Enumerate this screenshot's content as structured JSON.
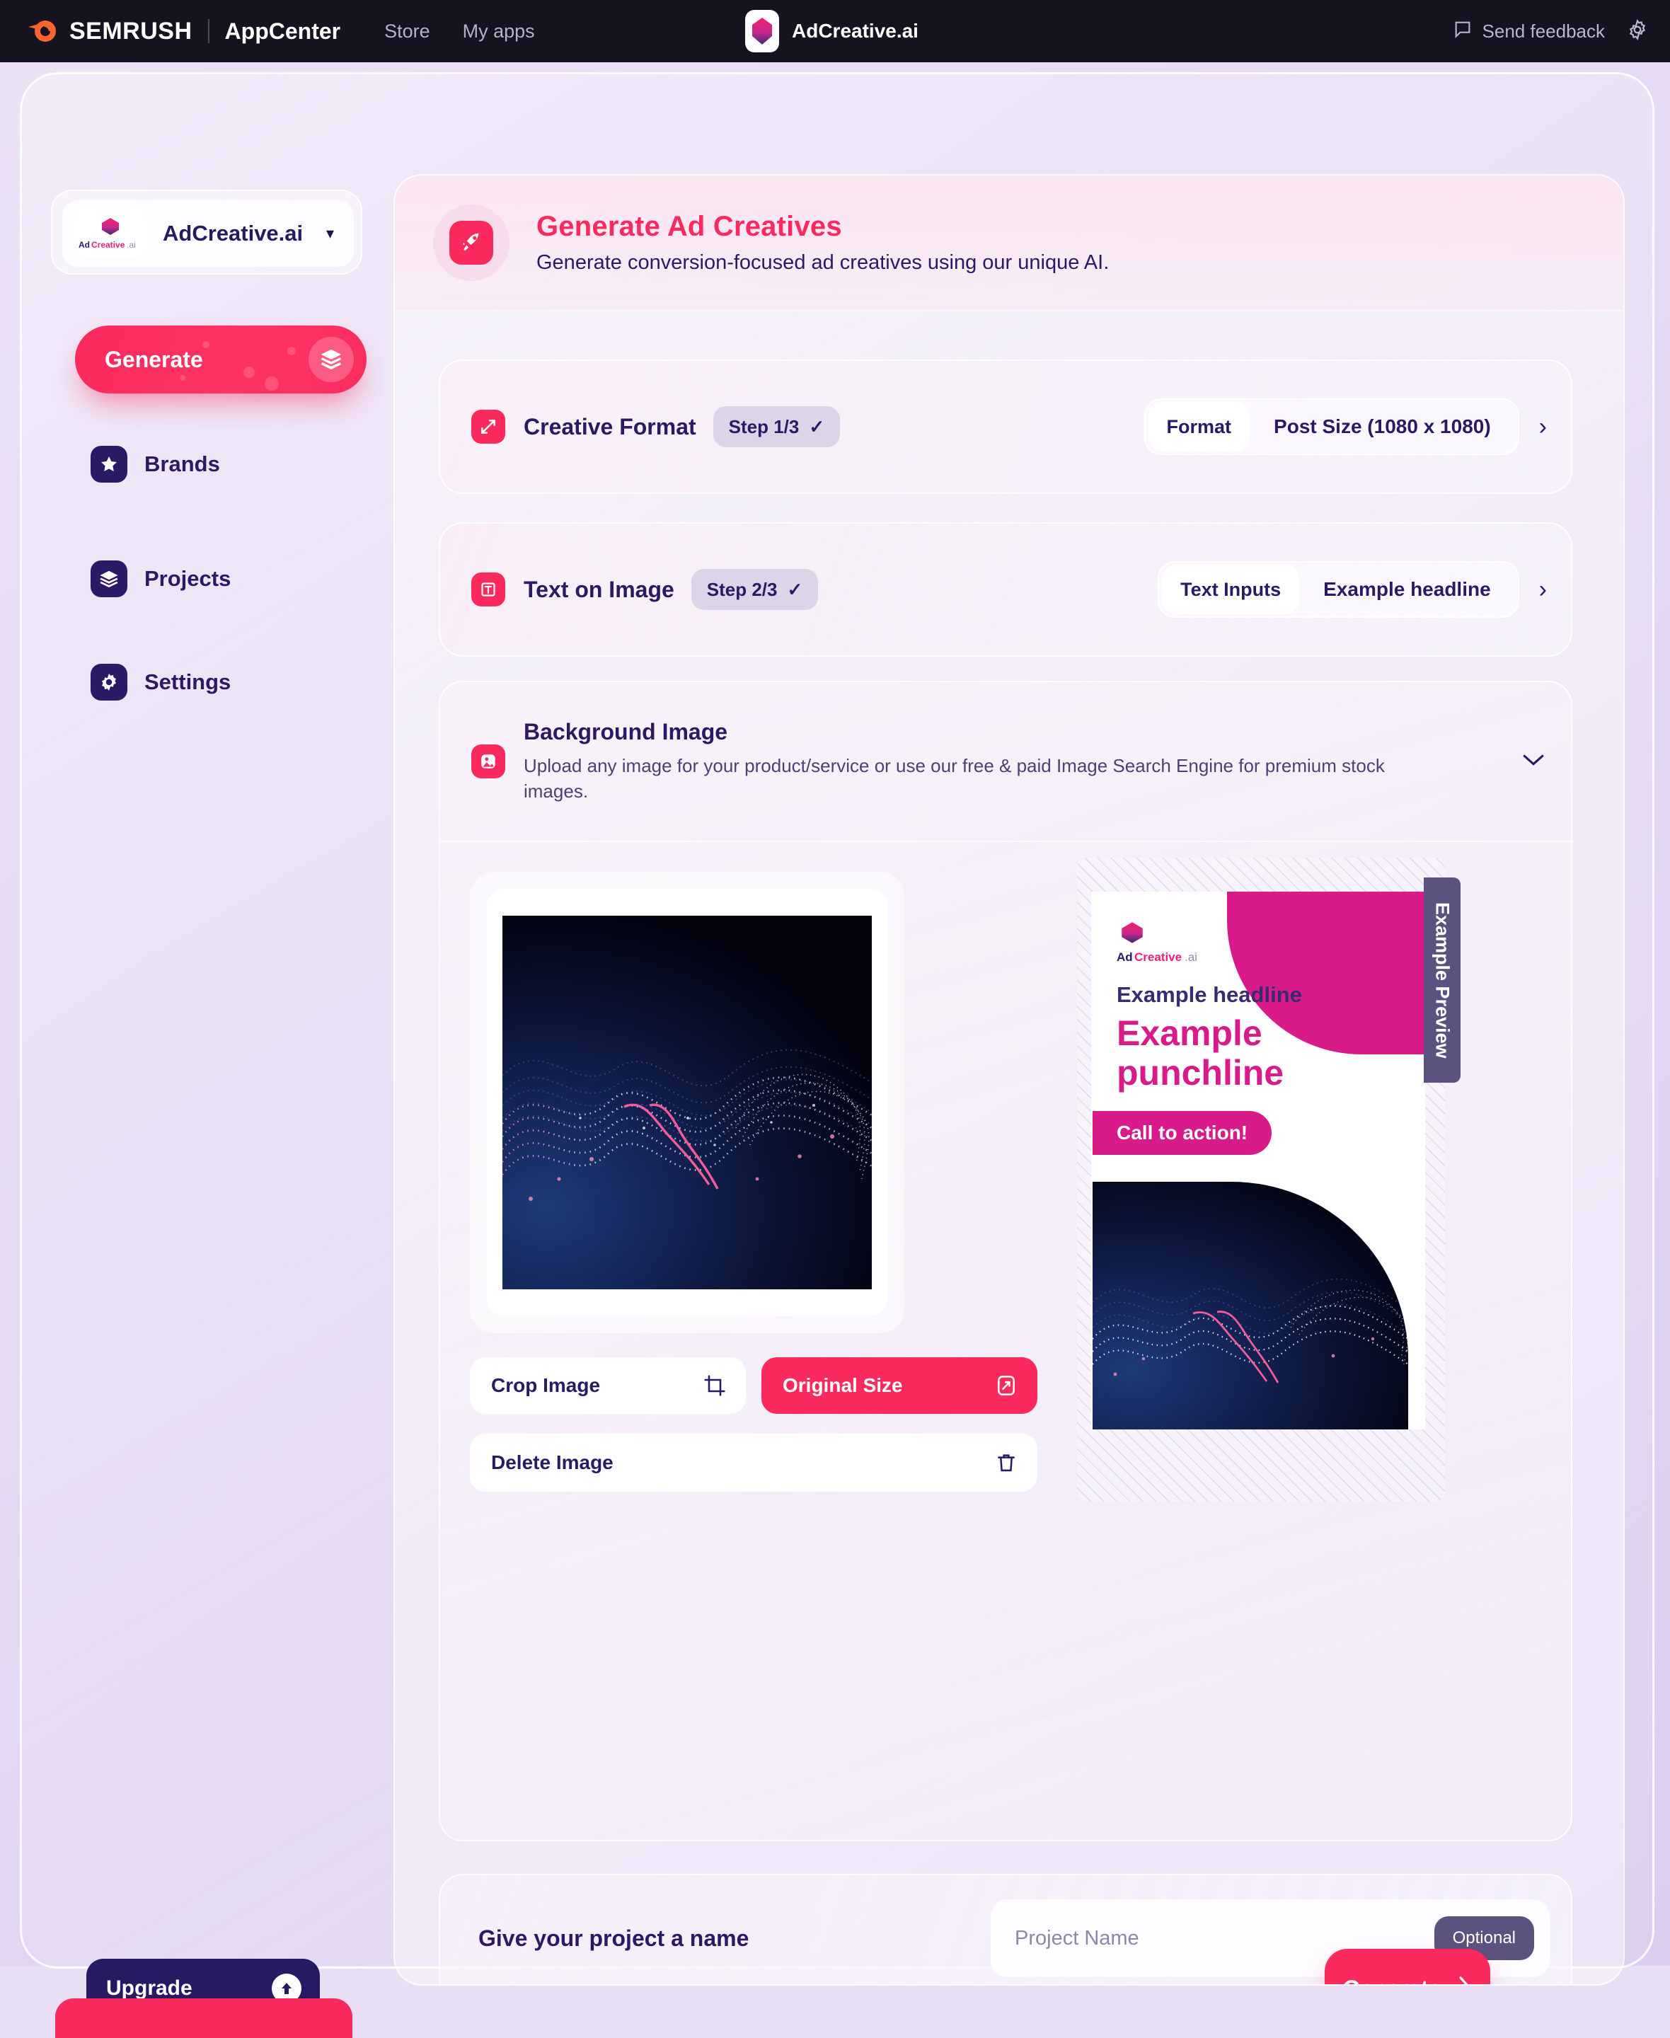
{
  "topbar": {
    "brand": "SEMRUSH",
    "product": "AppCenter",
    "nav": [
      {
        "label": "Store"
      },
      {
        "label": "My apps"
      }
    ],
    "app_name": "AdCreative.ai",
    "feedback_label": "Send feedback",
    "icons": {
      "feedback": "comment-icon",
      "settings": "gear-icon"
    }
  },
  "sidebar": {
    "brand_selector": {
      "logo_text": "AdCreative.ai",
      "name": "AdCreative.ai",
      "caret": "▾"
    },
    "generate_button": {
      "label": "Generate",
      "icon": "layers-icon"
    },
    "items": [
      {
        "label": "Brands",
        "icon": "star-icon"
      },
      {
        "label": "Projects",
        "icon": "layers-icon"
      },
      {
        "label": "Settings",
        "icon": "gear-icon"
      }
    ],
    "upgrade": {
      "label": "Upgrade",
      "icon": "arrow-up-circle-icon"
    }
  },
  "main": {
    "header": {
      "icon": "rocket-icon",
      "title": "Generate Ad Creatives",
      "subtitle": "Generate conversion-focused ad creatives using our unique AI."
    },
    "steps": [
      {
        "icon": "expand-arrows-icon",
        "title": "Creative Format",
        "badge": "Step 1/3",
        "badge_check": "✓",
        "value_label": "Format",
        "value": "Post Size (1080 x 1080)",
        "chevron": "›"
      },
      {
        "icon": "text-icon",
        "title": "Text on Image",
        "badge": "Step 2/3",
        "badge_check": "✓",
        "value_label": "Text Inputs",
        "value": "Example headline",
        "chevron": "›"
      }
    ],
    "background_image": {
      "icon": "image-icon",
      "title": "Background Image",
      "description": "Upload any image for your product/service or use our free & paid Image Search Engine for premium stock images.",
      "chevron": "⌄",
      "actions": [
        {
          "label": "Crop Image",
          "icon": "crop-icon",
          "style": "white"
        },
        {
          "label": "Original Size",
          "icon": "resize-icon",
          "style": "pink"
        },
        {
          "label": "Delete Image",
          "icon": "trash-icon",
          "style": "white"
        }
      ],
      "preview": {
        "tab_label": "Example Preview",
        "logo_text": "AdCreative.ai",
        "headline": "Example headline",
        "punchline": "Example punchline",
        "cta": "Call to action!"
      }
    },
    "project": {
      "label": "Give your project a name",
      "placeholder": "Project Name",
      "value": "",
      "badge": "Optional"
    },
    "generate": {
      "label": "Generate",
      "chevron": "›"
    }
  },
  "colors": {
    "pink": "#fb2a5e",
    "magenta": "#d81b89",
    "navy": "#2a1a66",
    "dark_bar": "#14131f",
    "orange": "#ff642d"
  }
}
